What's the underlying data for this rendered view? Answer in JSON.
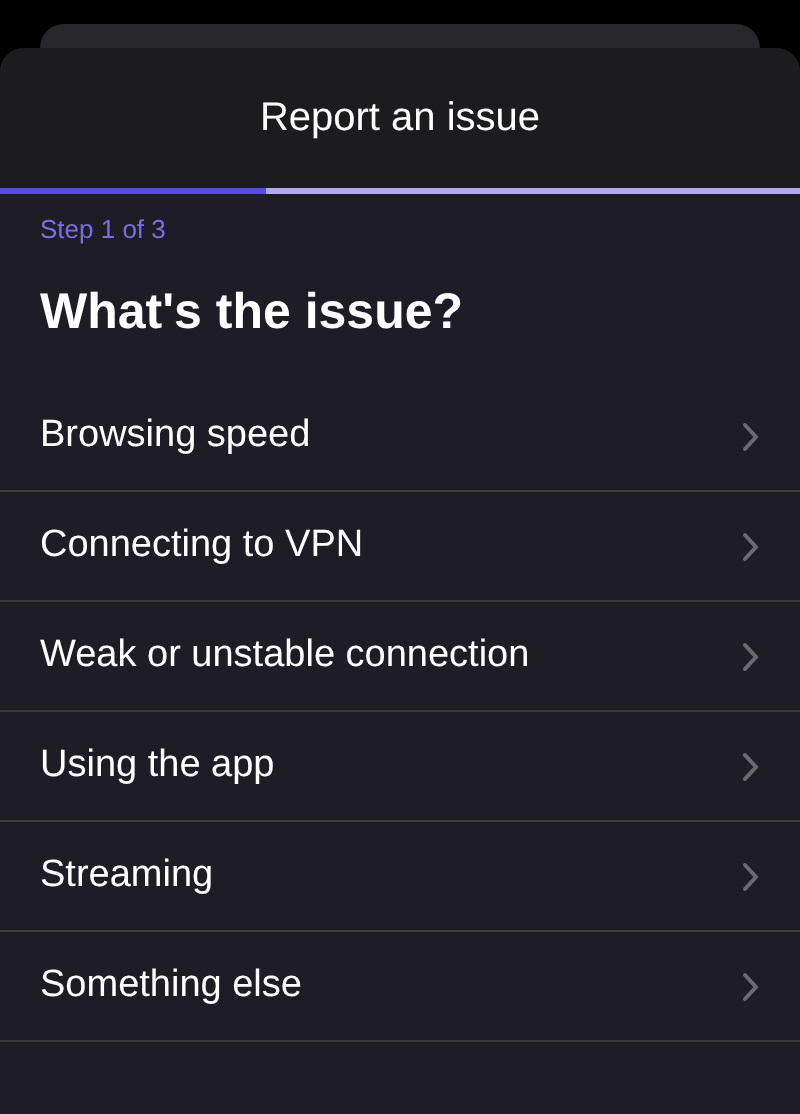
{
  "sheet": {
    "title": "Report an issue"
  },
  "progress": {
    "level": 0.333
  },
  "step": "Step 1 of 3",
  "heading": "What's the issue?",
  "options": [
    {
      "label": "Browsing speed"
    },
    {
      "label": "Connecting to VPN"
    },
    {
      "label": "Weak or unstable connection"
    },
    {
      "label": "Using the app"
    },
    {
      "label": "Streaming"
    },
    {
      "label": "Something else"
    }
  ]
}
